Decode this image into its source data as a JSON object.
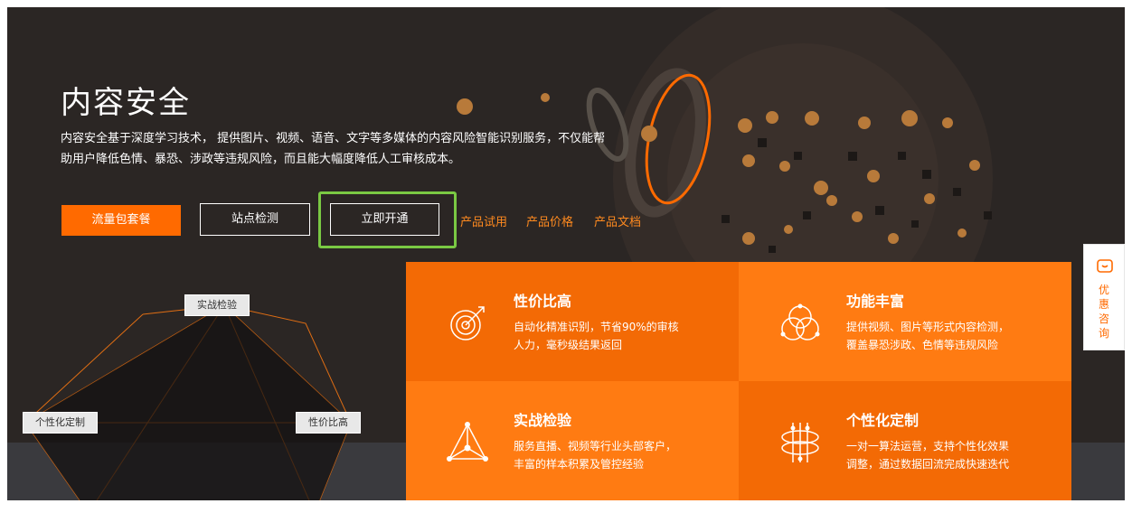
{
  "hero": {
    "title": "内容安全",
    "desc_line1": "内容安全基于深度学习技术， 提供图片、视频、语音、文字等多媒体的内容风险智能识别服务，不仅能帮",
    "desc_line2": "助用户降低色情、暴恐、涉政等违规风险，而且能大幅度降低人工审核成本。"
  },
  "actions": {
    "traffic_pack": "流量包套餐",
    "site_check": "站点检测",
    "activate_now": "立即开通",
    "links": [
      "产品试用",
      "产品价格",
      "产品文档"
    ]
  },
  "features": [
    {
      "title": "性价比高",
      "line1": "自动化精准识别，节省90%的审核",
      "line2": "人力，毫秒级结果返回",
      "icon": "target-icon"
    },
    {
      "title": "功能丰富",
      "line1": "提供视频、图片等形式内容检测，",
      "line2": "覆盖暴恐涉政、色情等违规风险",
      "icon": "venn-icon"
    },
    {
      "title": "实战检验",
      "line1": "服务直播、视频等行业头部客户，",
      "line2": "丰富的样本积累及管控经验",
      "icon": "triangle-network-icon"
    },
    {
      "title": "个性化定制",
      "line1": "一对一算法运营，支持个性化效果",
      "line2": "调整，通过数据回流完成快速迭代",
      "icon": "customize-icon"
    }
  ],
  "diagram_tags": [
    "实战检验",
    "个性化定制",
    "性价比高"
  ],
  "sidebar": {
    "label_chars": [
      "优",
      "惠",
      "咨",
      "询"
    ],
    "icon": "consult-icon"
  },
  "colors": {
    "accent": "#ff6a00",
    "banner_bg": "#2b2624",
    "highlight_box": "#7ac943"
  }
}
